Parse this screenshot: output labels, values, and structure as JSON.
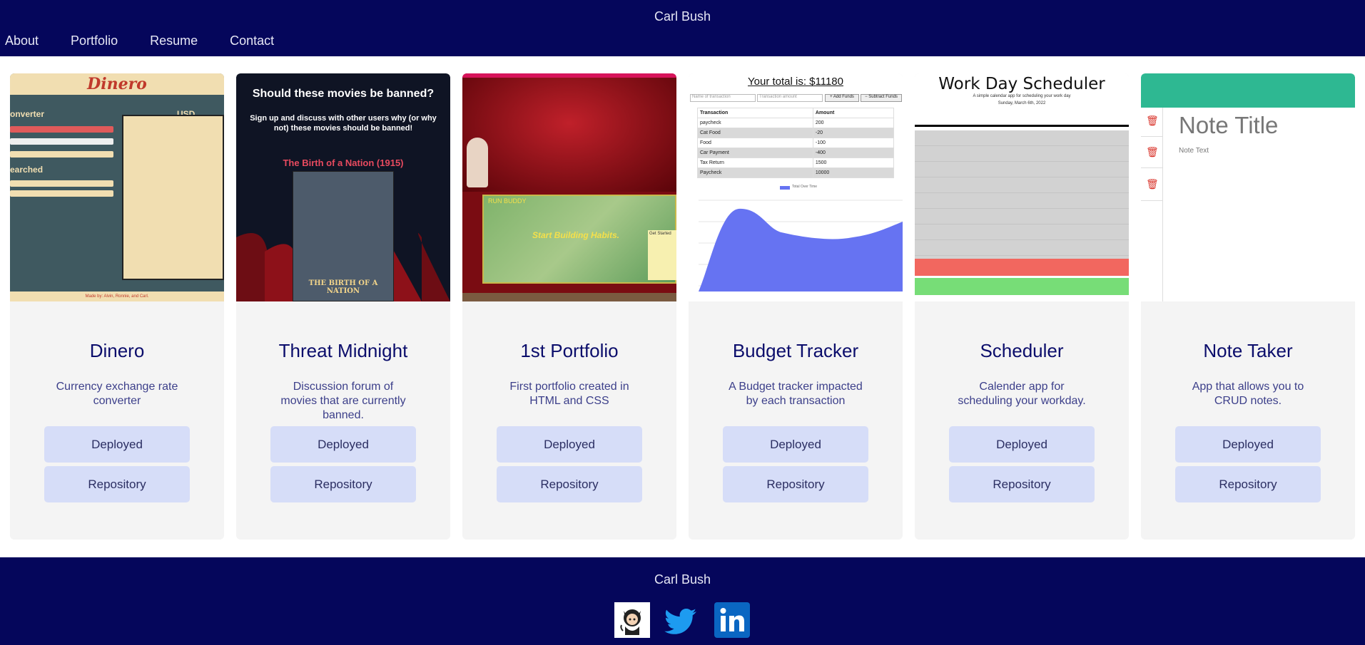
{
  "header": {
    "brand": "Carl Bush",
    "nav": [
      "About",
      "Portfolio",
      "Resume",
      "Contact"
    ]
  },
  "projects": [
    {
      "title": "Dinero",
      "description": "Currency exchange rate converter",
      "deployed_label": "Deployed",
      "repository_label": "Repository"
    },
    {
      "title": "Threat Midnight",
      "description": "Discussion forum of movies that are currently banned.",
      "deployed_label": "Deployed",
      "repository_label": "Repository"
    },
    {
      "title": "1st Portfolio",
      "description": "First portfolio created in HTML and CSS",
      "deployed_label": "Deployed",
      "repository_label": "Repository"
    },
    {
      "title": "Budget Tracker",
      "description": "A Budget tracker impacted by each transaction",
      "deployed_label": "Deployed",
      "repository_label": "Repository"
    },
    {
      "title": "Scheduler",
      "description": "Calender app for scheduling your workday.",
      "deployed_label": "Deployed",
      "repository_label": "Repository"
    },
    {
      "title": "Note Taker",
      "description": "App that allows you to CRUD notes.",
      "deployed_label": "Deployed",
      "repository_label": "Repository"
    }
  ],
  "thumbs": {
    "dinero": {
      "logo": "Dinero",
      "converter": "onverter",
      "currency": "USD Curren",
      "searched": "earched",
      "footer": "Made by: Alvin, Ronnie, and Carl."
    },
    "threat": {
      "heading": "Should these movies be banned?",
      "sub": "Sign up and discuss with other users why (or why not) these movies should be banned!",
      "movie": "The Birth of a Nation (1915)",
      "poster": "THE BIRTH OF A NATION"
    },
    "portfolio": {
      "run": "RUN BUDDY",
      "habits": "Start Building Habits.",
      "started": "Get Started"
    },
    "budget": {
      "total": "Your total is: $11180",
      "name_ph": "Name of transaction",
      "amount_ph": "Transaction amount",
      "add": "+ Add Funds",
      "subtract": "− Subtract Funds",
      "col_transaction": "Transaction",
      "col_amount": "Amount",
      "rows": [
        {
          "name": "paycheck",
          "amount": "200"
        },
        {
          "name": "Cat Food",
          "amount": "-20"
        },
        {
          "name": "Food",
          "amount": "-100"
        },
        {
          "name": "Car Payment",
          "amount": "-400"
        },
        {
          "name": "Tax Return",
          "amount": "1500"
        },
        {
          "name": "Paycheck",
          "amount": "10000"
        }
      ],
      "legend": "Total Over Time"
    },
    "scheduler": {
      "title": "Work Day Scheduler",
      "subtitle": "A simple calendar app for scheduling your work day",
      "date": "Sunday, March 6th, 2022"
    },
    "note": {
      "title_placeholder": "Note Title",
      "text_placeholder": "Note Text"
    }
  },
  "footer": {
    "brand": "Carl Bush",
    "social": [
      "github-icon",
      "twitter-icon",
      "linkedin-icon"
    ]
  },
  "colors": {
    "navy": "#05065b",
    "card": "#f4f4f4",
    "button": "#d6ddf8",
    "title": "#0b0d6b"
  }
}
